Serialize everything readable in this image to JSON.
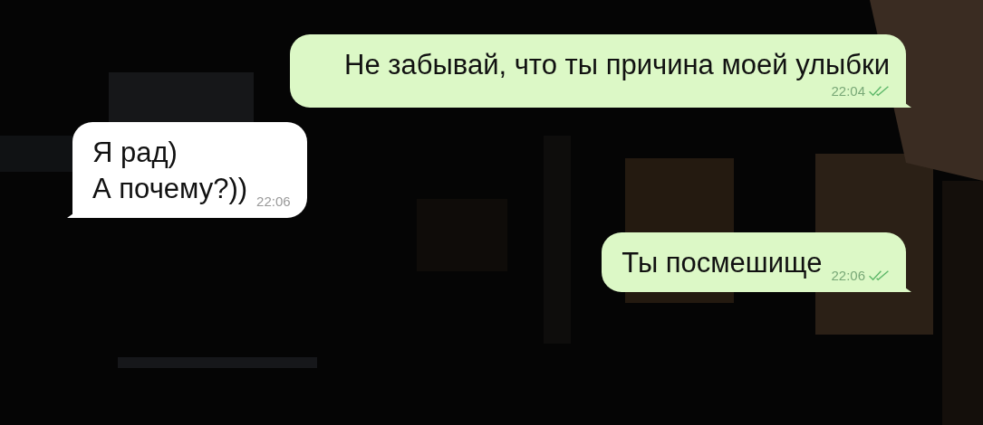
{
  "messages": [
    {
      "kind": "outgoing",
      "text": "Не забывай, что ты причина моей улыбки",
      "time": "22:04",
      "read": true
    },
    {
      "kind": "incoming",
      "text": "Я рад)\nА почему?))",
      "time": "22:06",
      "read": false
    },
    {
      "kind": "outgoing",
      "text": "Ты посмешище",
      "time": "22:06",
      "read": true
    }
  ]
}
